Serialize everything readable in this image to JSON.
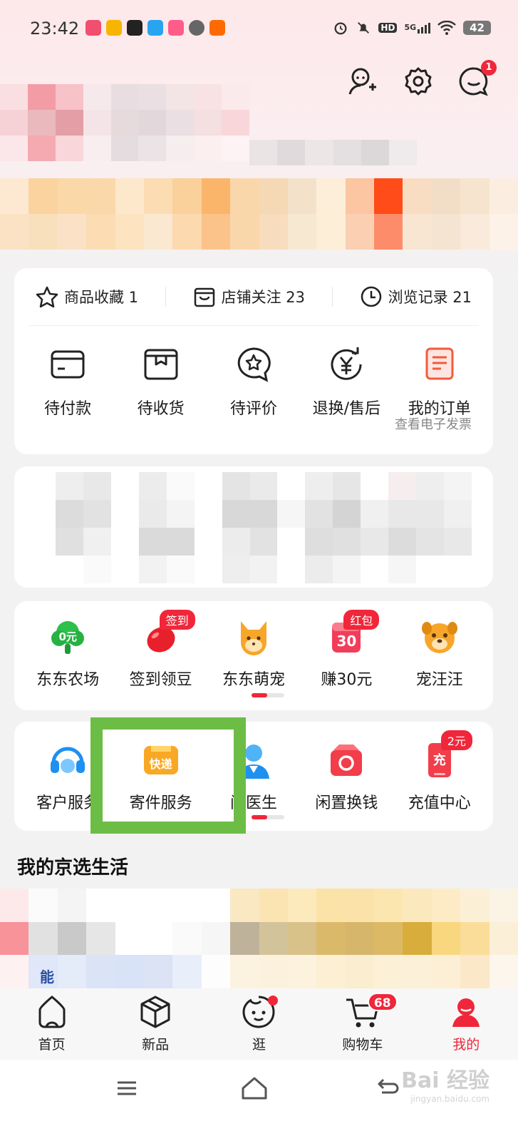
{
  "status_bar": {
    "time": "23:42",
    "network": "5G",
    "hd": "HD",
    "battery": "42"
  },
  "header": {
    "message_badge": "1"
  },
  "stats": [
    {
      "label": "商品收藏 1",
      "icon": "star-icon"
    },
    {
      "label": "店铺关注 23",
      "icon": "shop-icon"
    },
    {
      "label": "浏览记录 21",
      "icon": "clock-icon"
    }
  ],
  "orders": [
    {
      "label": "待付款",
      "icon": "wallet-icon"
    },
    {
      "label": "待收货",
      "icon": "package-icon"
    },
    {
      "label": "待评价",
      "icon": "review-icon"
    },
    {
      "label": "退换/售后",
      "icon": "refund-icon"
    },
    {
      "label": "我的订单",
      "icon": "order-list-icon"
    }
  ],
  "orders_subnote": "查看电子发票",
  "activities": [
    {
      "label": "东东农场",
      "icon": "farm-tree-icon",
      "icon_text": "0元"
    },
    {
      "label": "签到领豆",
      "icon": "bean-icon",
      "tag": "签到"
    },
    {
      "label": "东东萌宠",
      "icon": "pet-cat-icon"
    },
    {
      "label": "赚30元",
      "icon": "calendar-icon",
      "icon_text": "30",
      "tag": "红包"
    },
    {
      "label": "宠汪汪",
      "icon": "dog-icon"
    }
  ],
  "services": [
    {
      "label": "客户服务",
      "icon": "headset-icon"
    },
    {
      "label": "寄件服务",
      "icon": "express-icon",
      "icon_text": "快递"
    },
    {
      "label": "问医生",
      "icon": "doctor-icon"
    },
    {
      "label": "闲置换钱",
      "icon": "recycle-icon"
    },
    {
      "label": "充值中心",
      "icon": "recharge-icon",
      "icon_text": "充",
      "tag": "2元"
    }
  ],
  "section_title": "我的京选生活",
  "partial_text": "能",
  "tabbar": [
    {
      "label": "首页",
      "icon": "home-icon"
    },
    {
      "label": "新品",
      "icon": "box-icon"
    },
    {
      "label": "逛",
      "icon": "browse-face-icon"
    },
    {
      "label": "购物车",
      "icon": "cart-icon",
      "badge": "68"
    },
    {
      "label": "我的",
      "icon": "profile-icon",
      "active": true
    }
  ],
  "watermark": {
    "text": "Bai 经验",
    "sub": "jingyan.baidu.com"
  },
  "colors": {
    "accent": "#f0273a",
    "highlight": "#6cbd45"
  }
}
